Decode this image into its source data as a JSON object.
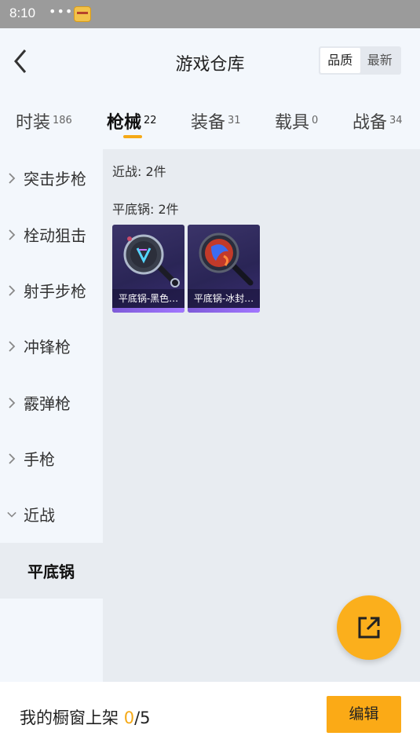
{
  "status_bar": {
    "time": "8:10",
    "more_icon": "more-dots-icon",
    "app_icon": "app-notification-icon"
  },
  "header": {
    "title": "游戏仓库",
    "back_icon": "back-arrow-icon",
    "sort_options": [
      {
        "label": "品质",
        "active": true
      },
      {
        "label": "最新",
        "active": false
      }
    ]
  },
  "tabs": [
    {
      "label": "时装",
      "count": "186",
      "active": false
    },
    {
      "label": "枪械",
      "count": "22",
      "active": true
    },
    {
      "label": "装备",
      "count": "31",
      "active": false
    },
    {
      "label": "载具",
      "count": "0",
      "active": false
    },
    {
      "label": "战备",
      "count": "34",
      "active": false
    }
  ],
  "sidebar": {
    "items": [
      {
        "label": "突击步枪",
        "expanded": false
      },
      {
        "label": "栓动狙击",
        "expanded": false
      },
      {
        "label": "射手步枪",
        "expanded": false
      },
      {
        "label": "冲锋枪",
        "expanded": false
      },
      {
        "label": "霰弹枪",
        "expanded": false
      },
      {
        "label": "手枪",
        "expanded": false
      },
      {
        "label": "近战",
        "expanded": true
      }
    ],
    "sub_item": "平底锅"
  },
  "main": {
    "category_summary": "近战: 2件",
    "group_summary": "平底锅: 2件",
    "items": [
      {
        "name": "平底锅-黑色…"
      },
      {
        "name": "平底锅-冰封…"
      }
    ]
  },
  "fab_icon": "share-export-icon",
  "bottom": {
    "label": "我的橱窗上架 ",
    "current": "0",
    "total": "/5",
    "edit_label": "编辑"
  },
  "colors": {
    "accent": "#fbaf1c",
    "tab_underline": "#f5a917",
    "card_bg": "#2f2a5e",
    "rarity": "#8f69ea"
  }
}
